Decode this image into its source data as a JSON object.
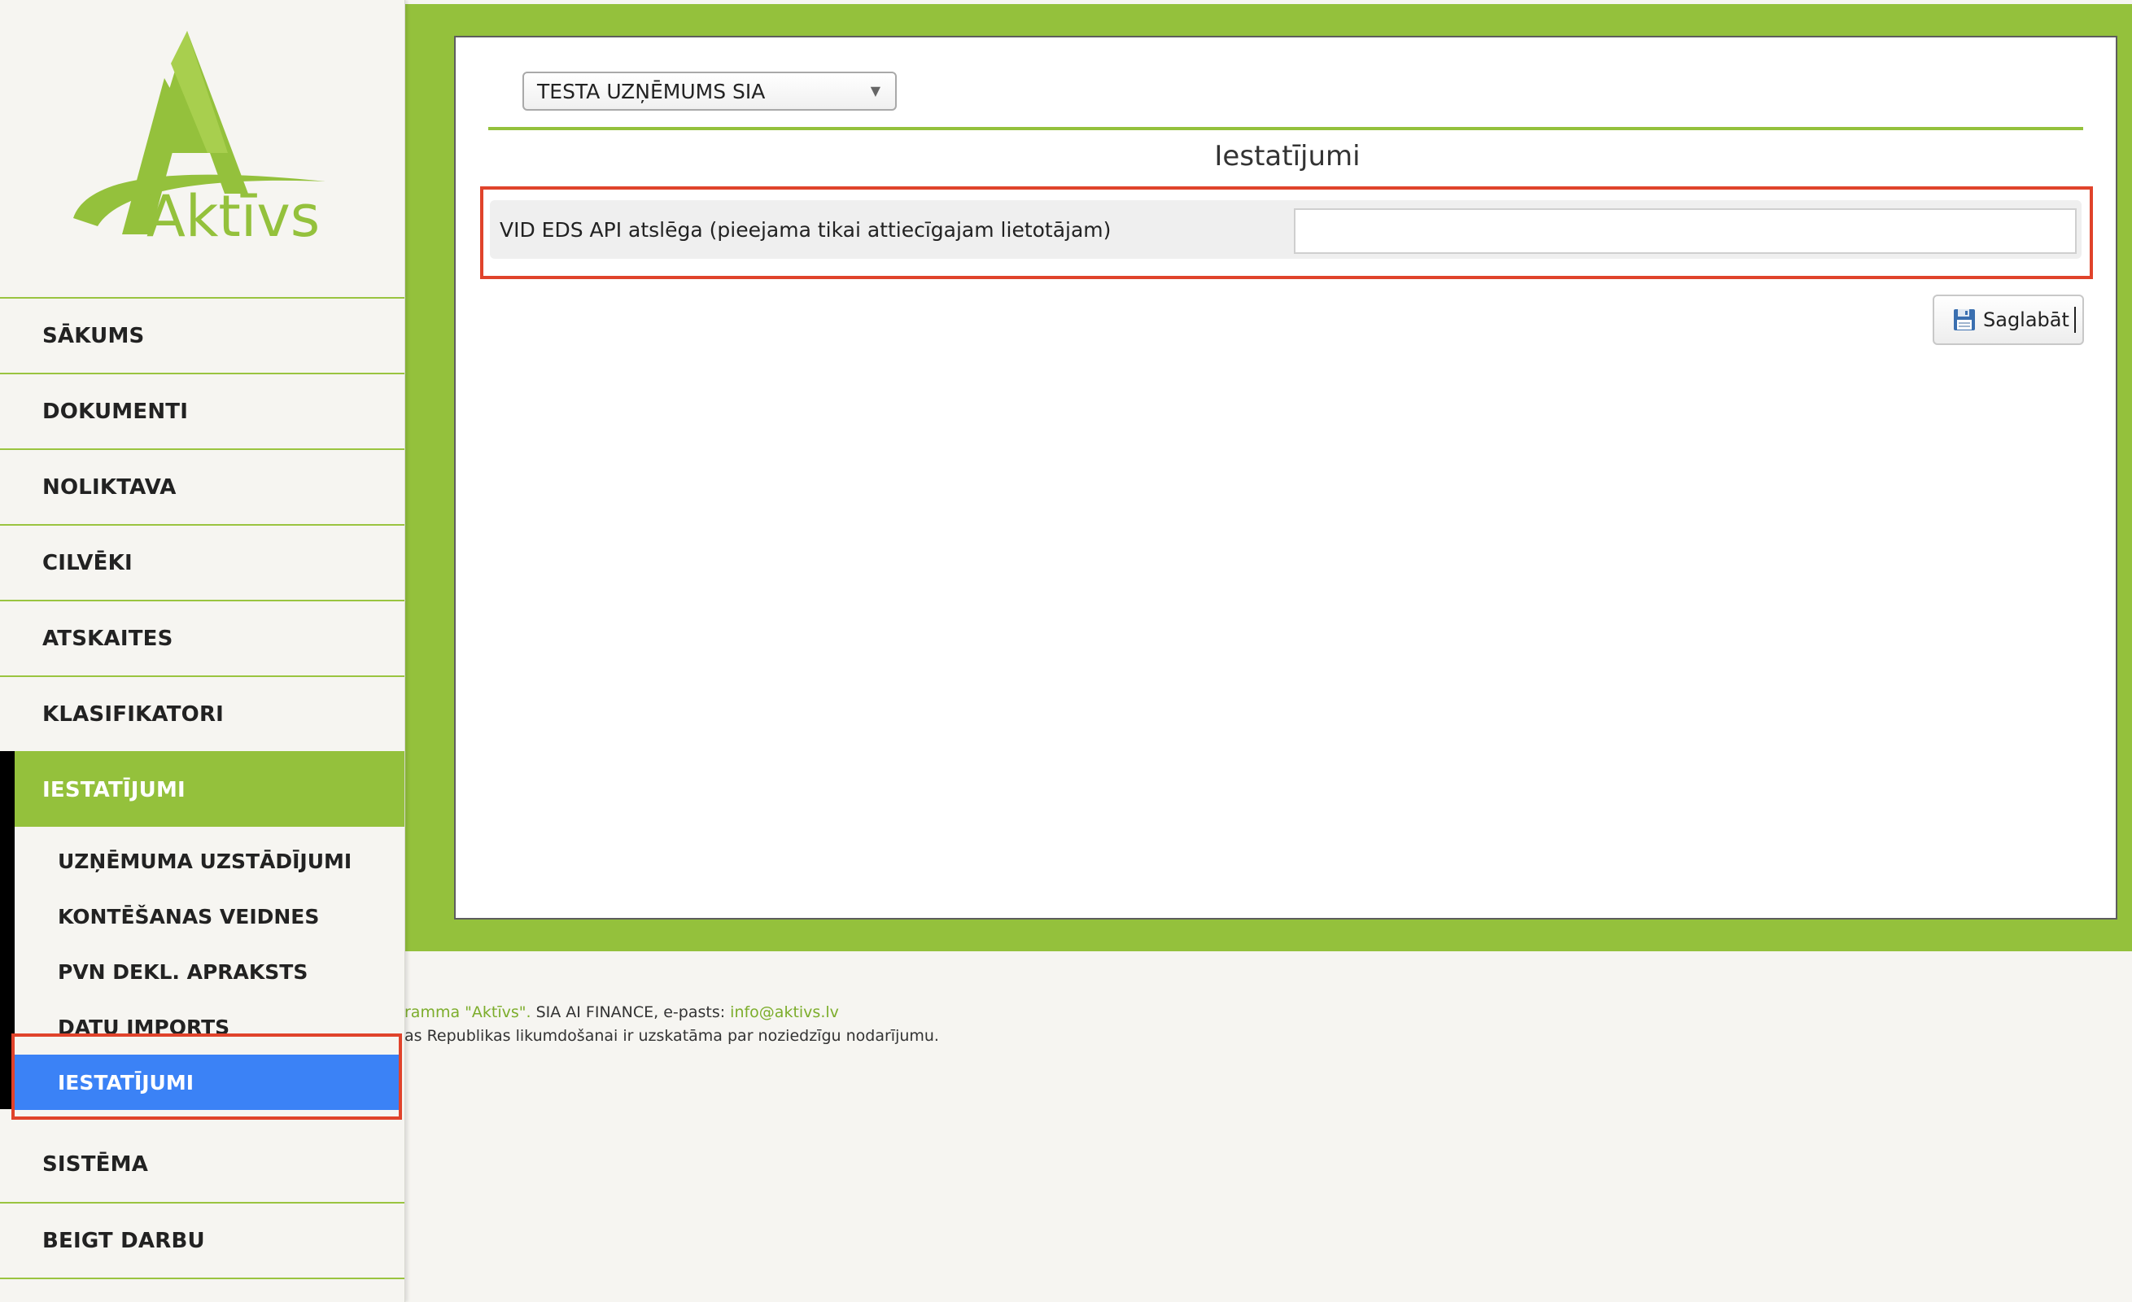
{
  "app": {
    "logo_text": "Aktīvs"
  },
  "menu": {
    "items": [
      {
        "label": "SĀKUMS"
      },
      {
        "label": "DOKUMENTI"
      },
      {
        "label": "NOLIKTAVA"
      },
      {
        "label": "CILVĒKI"
      },
      {
        "label": "ATSKAITES"
      },
      {
        "label": "KLASIFIKATORI"
      }
    ],
    "active_group": {
      "label": "IESTATĪJUMI",
      "subitems": [
        {
          "label": "UZŅĒMUMA UZSTĀDĪJUMI"
        },
        {
          "label": "KONTĒŠANAS VEIDNES"
        },
        {
          "label": "PVN DEKL. APRAKSTS"
        },
        {
          "label": "DATU IMPORTS"
        },
        {
          "label": "IESTATĪJUMI"
        }
      ]
    },
    "after_items": [
      {
        "label": "SISTĒMA"
      },
      {
        "label": "BEIGT DARBU"
      }
    ]
  },
  "main": {
    "company_select": {
      "value": "TESTA UZŅĒMUMS SIA",
      "arrow": "▼"
    },
    "title": "Iestatījumi",
    "setting": {
      "label": "VID EDS API atslēga (pieejama tikai attiecīgajam lietotājam)",
      "value": ""
    },
    "save_label": "Saglabāt"
  },
  "footer": {
    "line1_green": "ramma \"Aktīvs\".",
    "line1_text": " SIA AI FINANCE, e-pasts: ",
    "email": "info@aktivs.lv",
    "line2": "as Republikas likumdošanai ir uzskatāma par noziedzīgu nodarījumu."
  },
  "colors": {
    "brand_green": "#94c13c",
    "selected_blue": "#3b82f6",
    "highlight_red": "#e0432b"
  }
}
